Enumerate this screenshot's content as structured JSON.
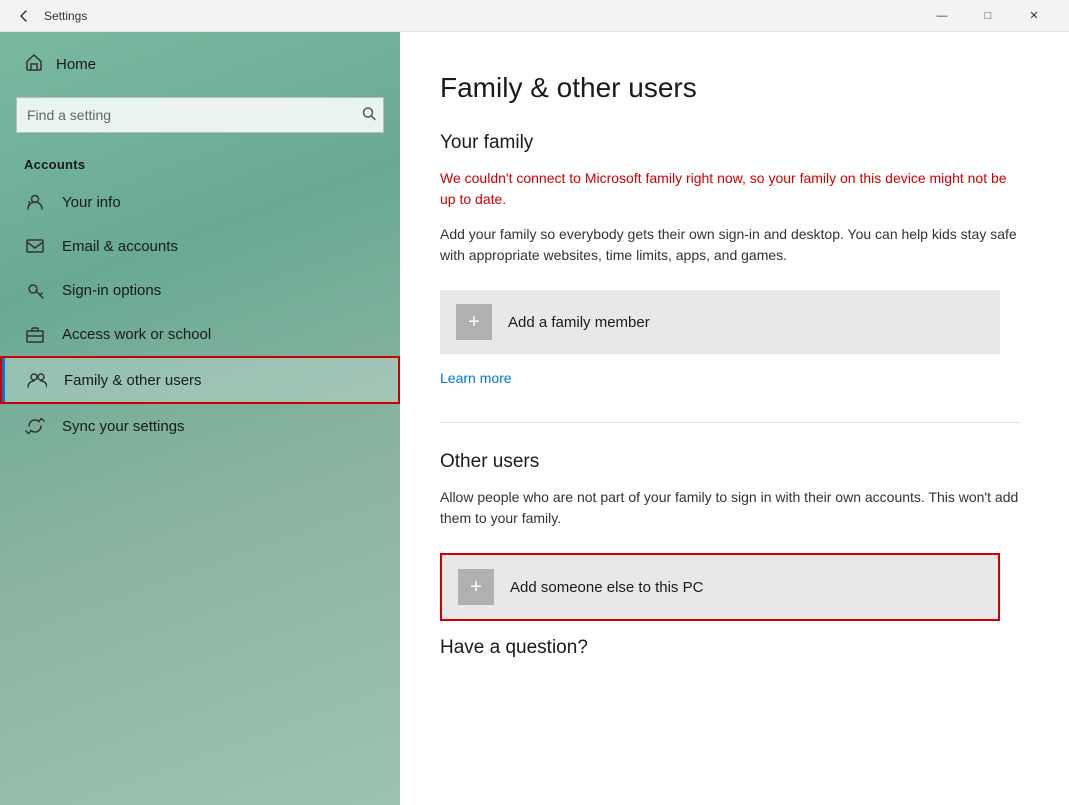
{
  "titlebar": {
    "back_label": "←",
    "title": "Settings",
    "minimize_label": "—",
    "maximize_label": "□",
    "close_label": "✕"
  },
  "sidebar": {
    "home_label": "Home",
    "search_placeholder": "Find a setting",
    "section_title": "Accounts",
    "items": [
      {
        "id": "your-info",
        "label": "Your info",
        "icon": "person"
      },
      {
        "id": "email-accounts",
        "label": "Email & accounts",
        "icon": "email"
      },
      {
        "id": "sign-in-options",
        "label": "Sign-in options",
        "icon": "key"
      },
      {
        "id": "access-work",
        "label": "Access work or school",
        "icon": "briefcase"
      },
      {
        "id": "family-other",
        "label": "Family & other users",
        "icon": "group",
        "active": true
      },
      {
        "id": "sync-settings",
        "label": "Sync your settings",
        "icon": "sync"
      }
    ]
  },
  "content": {
    "page_title": "Family & other users",
    "your_family_section": "Your family",
    "error_text": "We couldn't connect to Microsoft family right now, so your family on this device might not be up to date.",
    "desc_text": "Add your family so everybody gets their own sign-in and desktop. You can help kids stay safe with appropriate websites, time limits, apps, and games.",
    "add_family_label": "Add a family member",
    "learn_more_label": "Learn more",
    "other_users_section": "Other users",
    "other_users_desc": "Allow people who are not part of your family to sign in with their own accounts. This won't add them to your family.",
    "add_someone_label": "Add someone else to this PC",
    "have_question": "Have a question?"
  }
}
